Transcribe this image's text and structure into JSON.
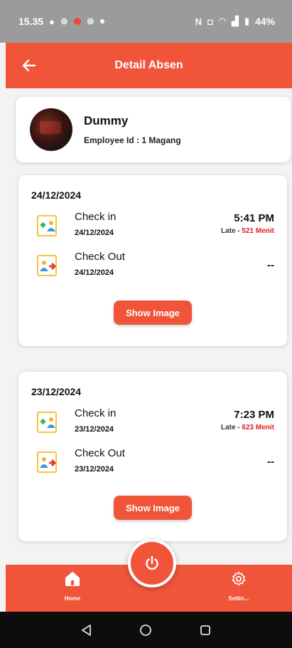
{
  "status_bar": {
    "time": "15.35",
    "battery": "44%"
  },
  "app_bar": {
    "title": "Detail Absen"
  },
  "profile": {
    "name": "Dummy",
    "employee_id_label": "Employee Id :",
    "employee_id": "1 Magang"
  },
  "records": [
    {
      "date": "24/12/2024",
      "check_in": {
        "label": "Check in",
        "date": "24/12/2024",
        "time": "5:41 PM",
        "late_label": "Late -",
        "late_value": "521 Menit"
      },
      "check_out": {
        "label": "Check Out",
        "date": "24/12/2024",
        "time": "--"
      },
      "button": "Show Image"
    },
    {
      "date": "23/12/2024",
      "check_in": {
        "label": "Check in",
        "date": "23/12/2024",
        "time": "7:23 PM",
        "late_label": "Late -",
        "late_value": "623 Menit"
      },
      "check_out": {
        "label": "Check Out",
        "date": "23/12/2024",
        "time": "--"
      },
      "button": "Show Image"
    }
  ],
  "bottom_nav": {
    "home": "Home",
    "settings": "Settin..."
  },
  "colors": {
    "primary": "#f0553a",
    "late": "#e02020",
    "icon_border": "#f4c33a"
  }
}
